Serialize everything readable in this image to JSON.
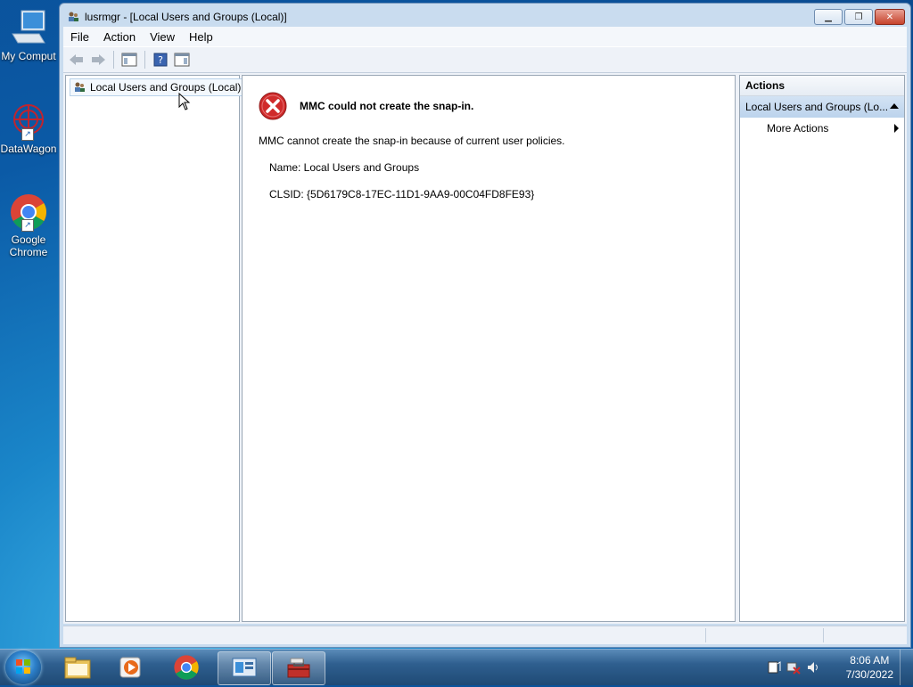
{
  "desktop": {
    "icons": [
      {
        "label": "My Comput"
      },
      {
        "label": "DataWagon"
      },
      {
        "label_line1": "Google",
        "label_line2": "Chrome"
      }
    ]
  },
  "window": {
    "title": "lusrmgr - [Local Users and Groups (Local)]",
    "menu": [
      "File",
      "Action",
      "View",
      "Help"
    ]
  },
  "tree": {
    "root": "Local Users and Groups (Local)"
  },
  "error": {
    "title": "MMC could not create the snap-in.",
    "message": "MMC cannot create the snap-in because of current user policies.",
    "name_line": "Name: Local Users and Groups",
    "clsid_line": "CLSID: {5D6179C8-17EC-11D1-9AA9-00C04FD8FE93}"
  },
  "actions": {
    "header": "Actions",
    "section": "Local Users and Groups (Lo...",
    "items": [
      "More Actions"
    ]
  },
  "clock": {
    "time": "8:06 AM",
    "date": "7/30/2022"
  },
  "colors": {
    "accent": "#1a86c9",
    "error_red": "#d02b2b"
  }
}
